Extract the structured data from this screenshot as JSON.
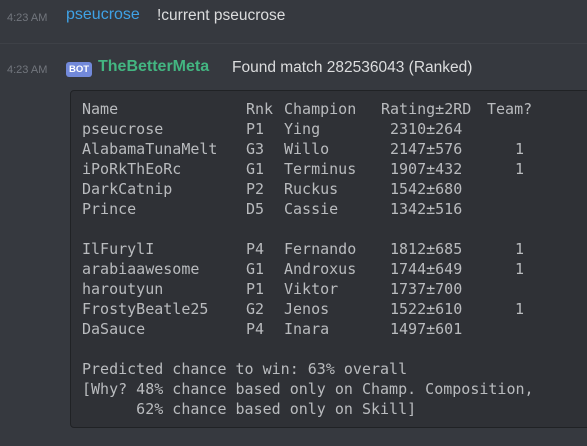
{
  "message1": {
    "timestamp": "4:23 AM",
    "username": "pseucrose",
    "text": "!current pseucrose"
  },
  "message2": {
    "timestamp": "4:23 AM",
    "badge": "BOT",
    "username": "TheBetterMeta",
    "text": "Found match 282536043 (Ranked)"
  },
  "table": {
    "headers": {
      "name": "Name",
      "rank": "Rnk",
      "champion": "Champion",
      "rating": "Rating±2RD",
      "team": "Team?"
    },
    "team1": [
      {
        "name": "pseucrose",
        "rank": "P1",
        "champion": "Ying",
        "rating": "2310±264",
        "team": ""
      },
      {
        "name": "AlabamaTunaMelt",
        "rank": "G3",
        "champion": "Willo",
        "rating": "2147±576",
        "team": "1"
      },
      {
        "name": "iPoRkThEoRc",
        "rank": "G1",
        "champion": "Terminus",
        "rating": "1907±432",
        "team": "1"
      },
      {
        "name": "DarkCatnip",
        "rank": "P2",
        "champion": "Ruckus",
        "rating": "1542±680",
        "team": ""
      },
      {
        "name": "Prince",
        "rank": "D5",
        "champion": "Cassie",
        "rating": "1342±516",
        "team": ""
      }
    ],
    "team2": [
      {
        "name": "IlFurylI",
        "rank": "P4",
        "champion": "Fernando",
        "rating": "1812±685",
        "team": "1"
      },
      {
        "name": "arabiaawesome",
        "rank": "G1",
        "champion": "Androxus",
        "rating": "1744±649",
        "team": "1"
      },
      {
        "name": "haroutyun",
        "rank": "P1",
        "champion": "Viktor",
        "rating": "1737±700",
        "team": ""
      },
      {
        "name": "FrostyBeatle25",
        "rank": "G2",
        "champion": "Jenos",
        "rating": "1522±610",
        "team": "1"
      },
      {
        "name": "DaSauce",
        "rank": "P4",
        "champion": "Inara",
        "rating": "1497±601",
        "team": ""
      }
    ]
  },
  "prediction": {
    "line1": "Predicted chance to win: 63% overall",
    "line2": "[Why? 48% chance based only on Champ. Composition,",
    "line3": "      62% chance based only on Skill]"
  }
}
